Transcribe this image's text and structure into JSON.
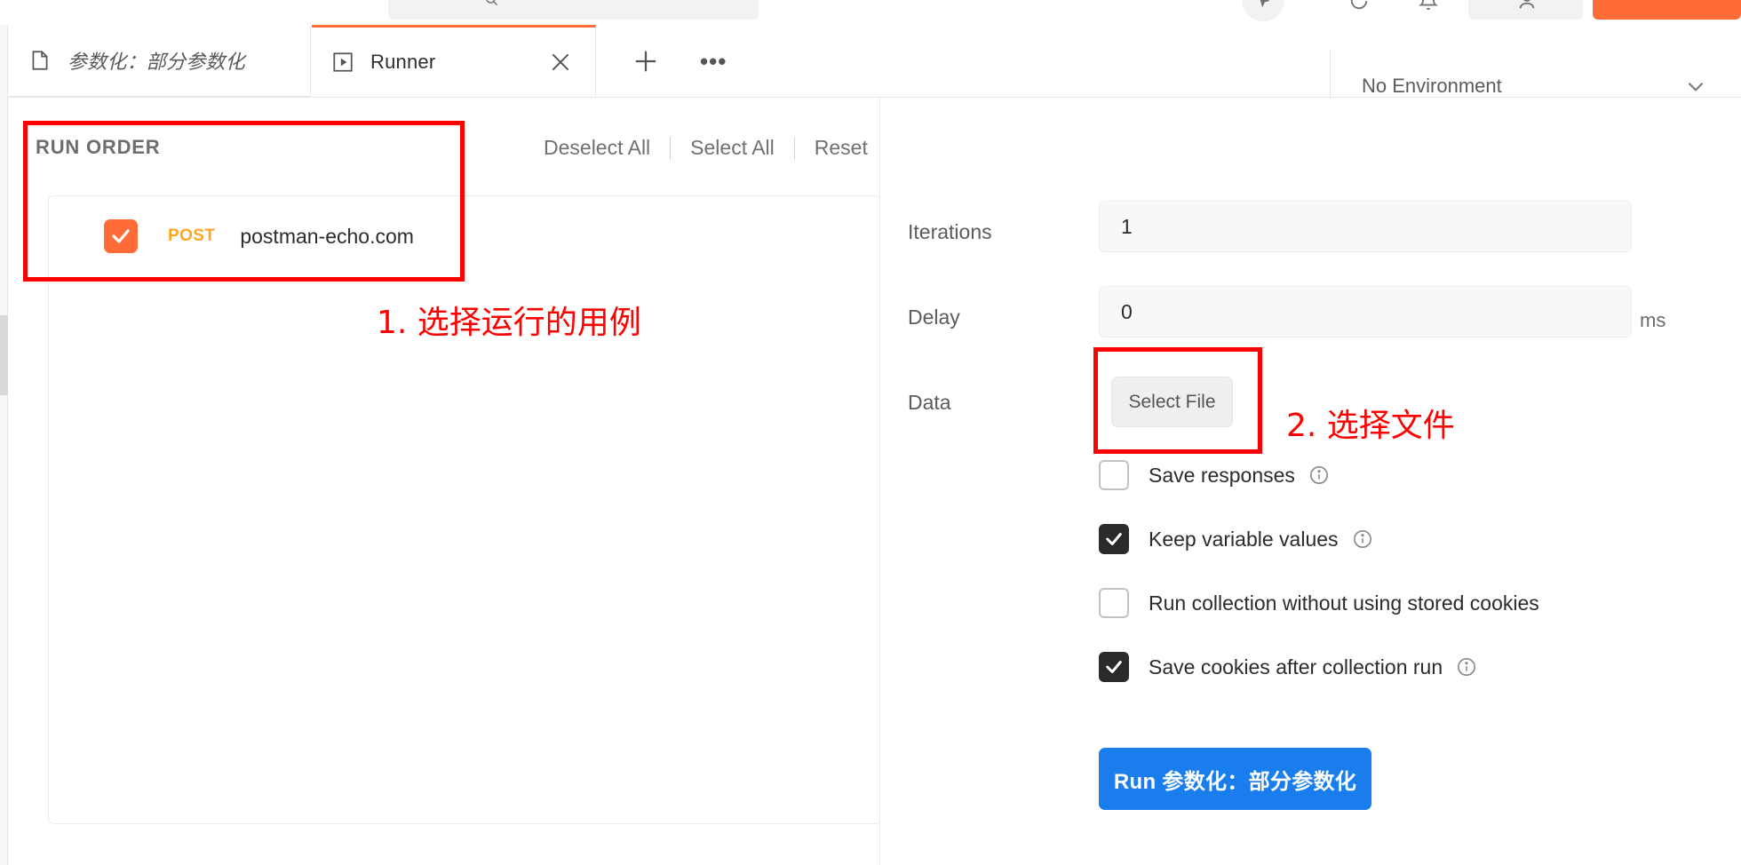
{
  "top_toolbar": {
    "search_icon": "search-icon",
    "icons": [
      "search-icon",
      "sync-icon",
      "bell-icon",
      "user-avatar-icon"
    ],
    "upgrade_button_label": ""
  },
  "tabs": {
    "items": [
      {
        "label": "参数化：部分参数化",
        "icon": "document-icon",
        "active": false,
        "italic": true
      },
      {
        "label": "Runner",
        "icon": "play-icon",
        "active": true,
        "italic": false
      }
    ],
    "close_icon": "close-icon",
    "new_tab_icon": "plus-icon",
    "more_icon": "ellipsis-icon"
  },
  "environment": {
    "selected": "No Environment",
    "caret_icon": "chevron-down-icon"
  },
  "run_order": {
    "title": "RUN ORDER",
    "actions": [
      {
        "label": "Deselect All"
      },
      {
        "label": "Select All"
      },
      {
        "label": "Reset"
      }
    ],
    "requests": [
      {
        "checked": true,
        "method": "POST",
        "name": "postman-echo.com"
      }
    ]
  },
  "settings": {
    "iterations": {
      "label": "Iterations",
      "value": "1"
    },
    "delay": {
      "label": "Delay",
      "value": "0",
      "unit": "ms"
    },
    "data": {
      "label": "Data",
      "button_label": "Select File"
    },
    "checkboxes": [
      {
        "label": "Save responses",
        "checked": false,
        "info": true
      },
      {
        "label": "Keep variable values",
        "checked": true,
        "info": true
      },
      {
        "label": "Run collection without using stored cookies",
        "checked": false,
        "info": false
      },
      {
        "label": "Save cookies after collection run",
        "checked": true,
        "info": true
      }
    ],
    "run_button": {
      "label": "Run 参数化：部分参数化"
    }
  },
  "annotations": [
    {
      "text": "1. 选择运行的用例"
    },
    {
      "text": "2. 选择文件"
    }
  ],
  "colors": {
    "accent_orange": "#ff6c37",
    "method_post": "#ffa724",
    "run_blue": "#1a7ded",
    "annotation_red": "#ff0000",
    "checkbox_on": "#2b2b2b"
  }
}
